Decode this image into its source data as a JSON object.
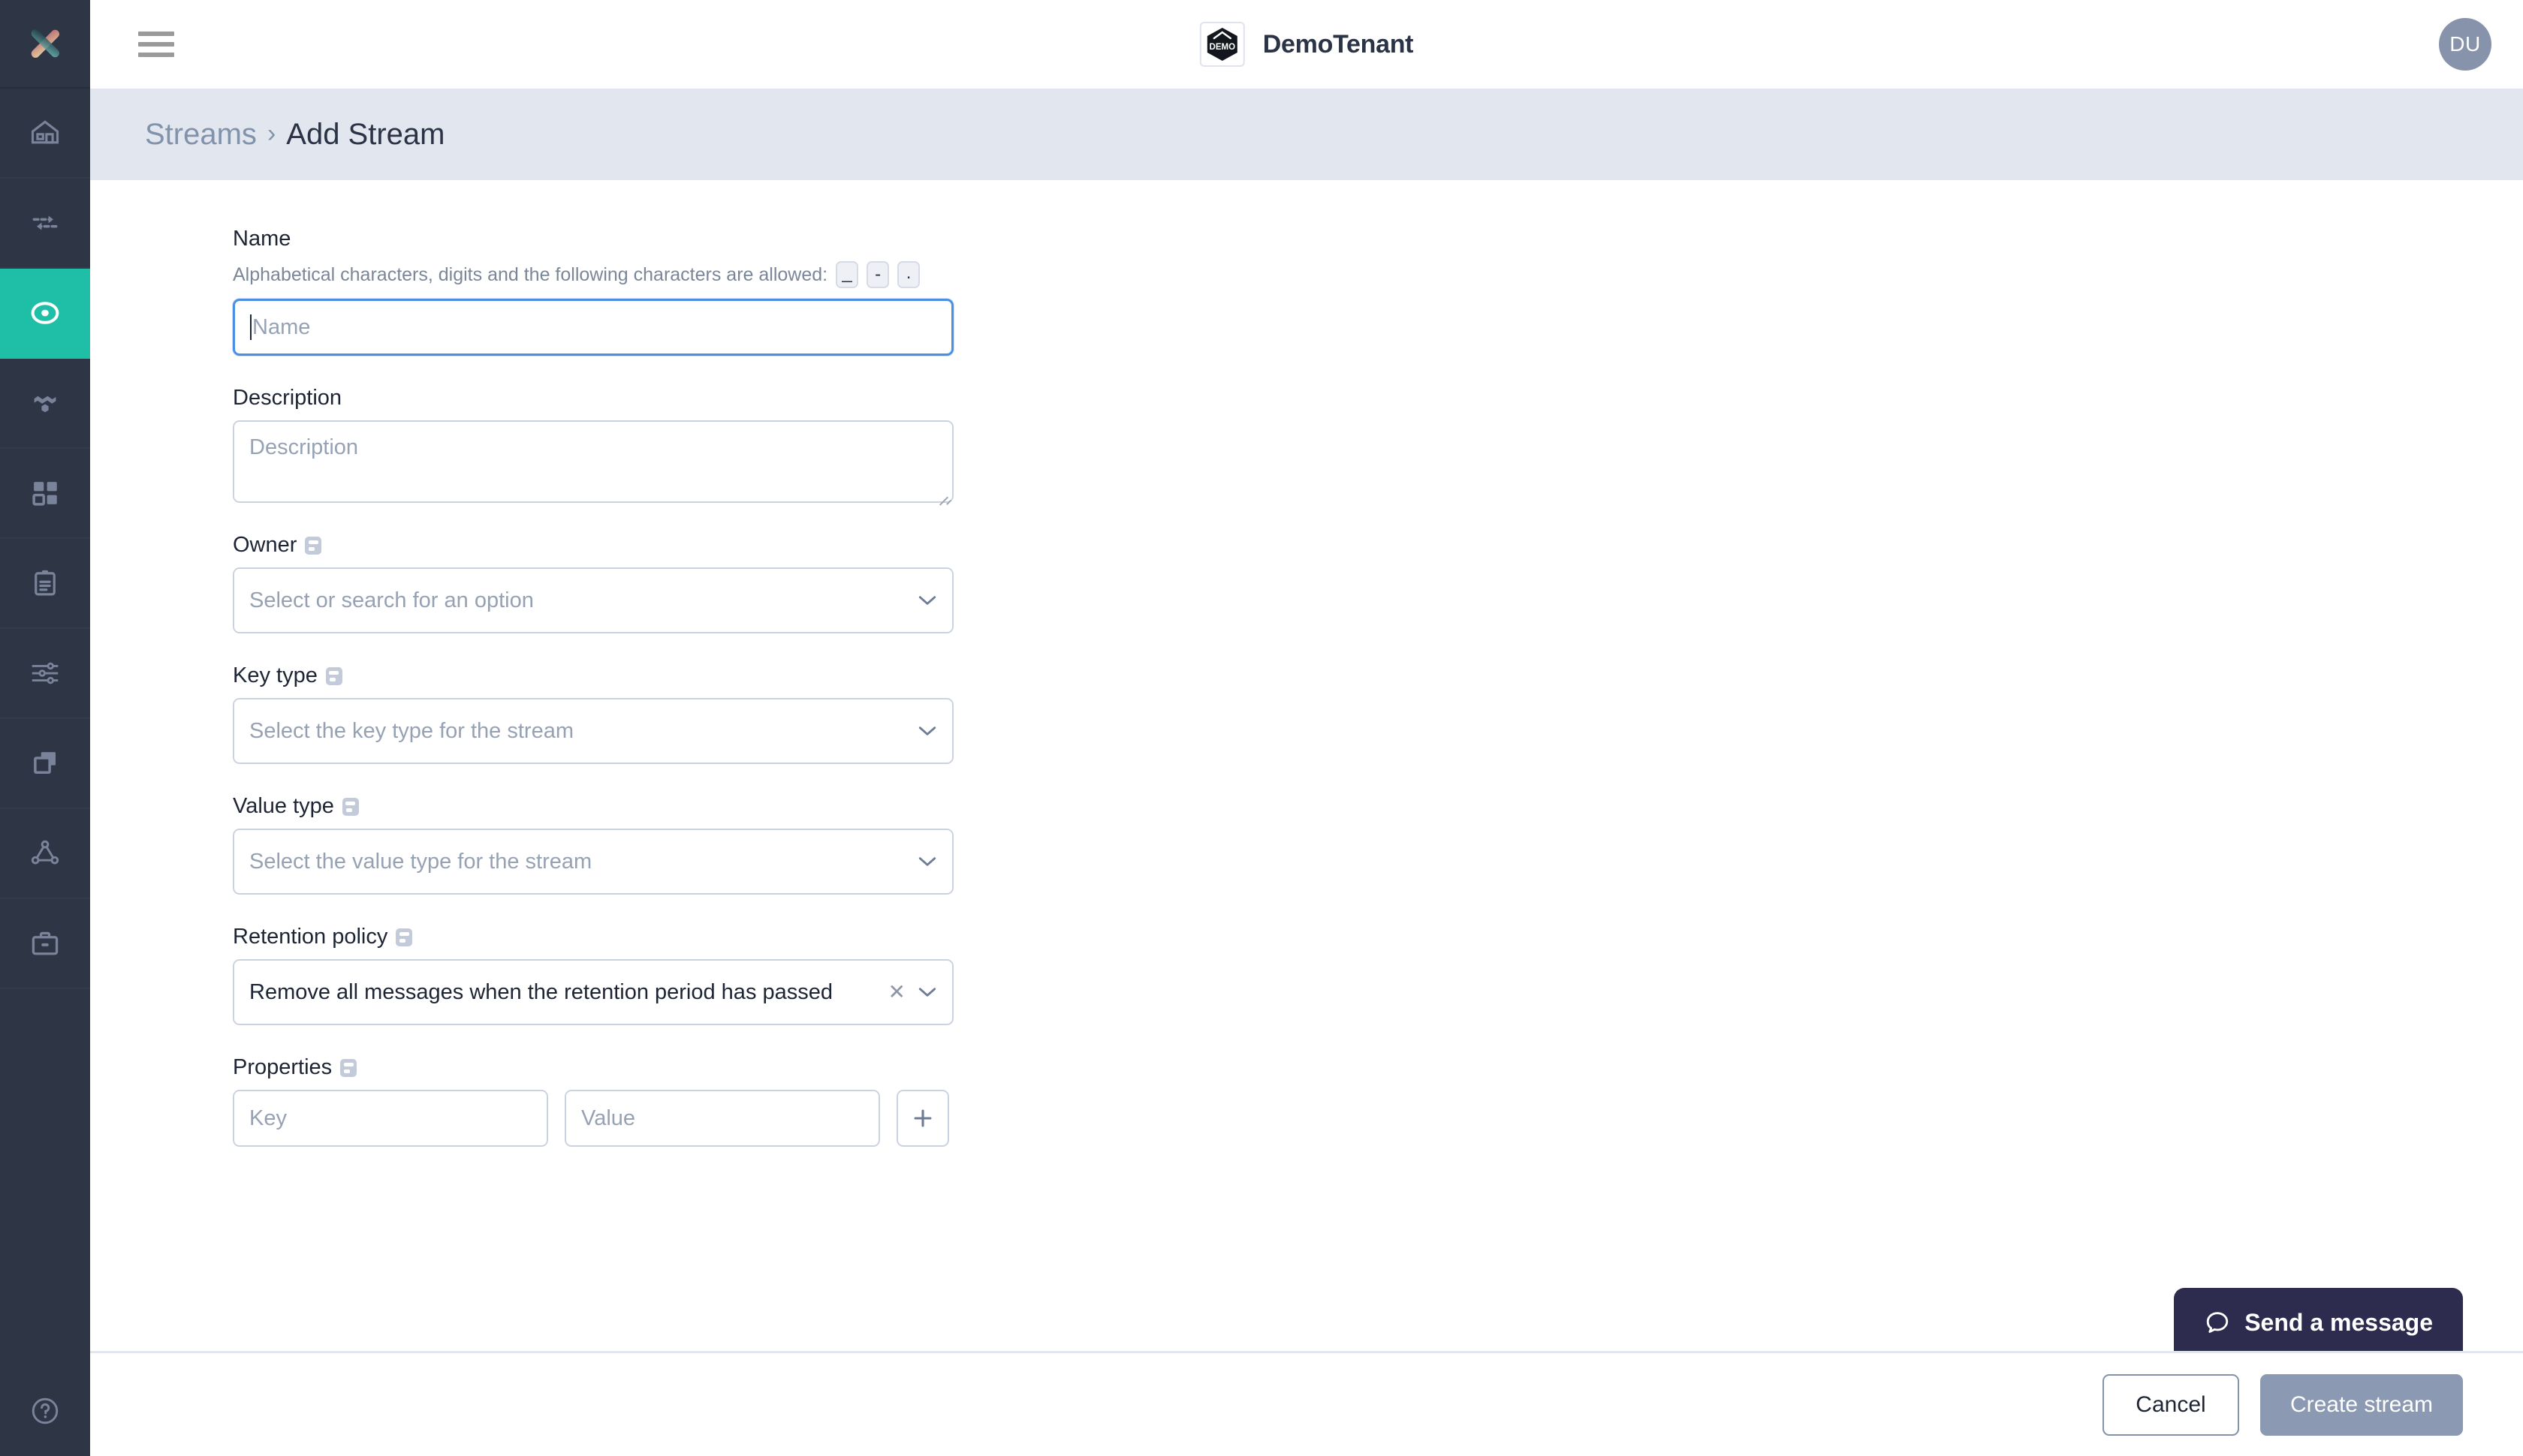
{
  "app": {
    "logo_icon": "x-cross-logo",
    "accent_color": "#1ebfa6",
    "sidebar_bg": "#2e3646",
    "breadcrumb_bg": "#e2e6ee"
  },
  "sidebar": {
    "items": [
      {
        "icon": "home-icon",
        "name": "sidebar-item-home",
        "active": false
      },
      {
        "icon": "exchange-icon",
        "name": "sidebar-item-exchange",
        "active": false
      },
      {
        "icon": "streams-icon",
        "name": "sidebar-item-streams",
        "active": true
      },
      {
        "icon": "topology-icon",
        "name": "sidebar-item-topology",
        "active": false
      },
      {
        "icon": "grid-icon",
        "name": "sidebar-item-apps",
        "active": false
      },
      {
        "icon": "clipboard-icon",
        "name": "sidebar-item-logs",
        "active": false
      },
      {
        "icon": "sliders-icon",
        "name": "sidebar-item-settings",
        "active": false
      },
      {
        "icon": "layers-icon",
        "name": "sidebar-item-layers",
        "active": false
      },
      {
        "icon": "network-icon",
        "name": "sidebar-item-network",
        "active": false
      },
      {
        "icon": "briefcase-icon",
        "name": "sidebar-item-briefcase",
        "active": false
      }
    ],
    "help_icon": "help-circle-icon"
  },
  "topbar": {
    "menu_icon": "hamburger-menu-icon",
    "tenant_logo_text": "DEMO",
    "tenant_name": "DemoTenant",
    "avatar_initials": "DU"
  },
  "breadcrumb": {
    "parent": "Streams",
    "separator": "›",
    "current": "Add Stream"
  },
  "form": {
    "name": {
      "label": "Name",
      "hint": "Alphabetical characters, digits and the following characters are allowed:",
      "allowed_chars": [
        "_",
        "-",
        "."
      ],
      "placeholder": "Name",
      "value": "",
      "focused": true
    },
    "description": {
      "label": "Description",
      "placeholder": "Description",
      "value": ""
    },
    "owner": {
      "label": "Owner",
      "placeholder": "Select or search for an option",
      "value": "",
      "has_info": true
    },
    "key_type": {
      "label": "Key type",
      "placeholder": "Select the key type for the stream",
      "value": "",
      "has_info": true
    },
    "value_type": {
      "label": "Value type",
      "placeholder": "Select the value type for the stream",
      "value": "",
      "has_info": true
    },
    "retention_policy": {
      "label": "Retention policy",
      "value": "Remove all messages when the retention period has passed",
      "has_info": true,
      "clearable": true
    },
    "properties": {
      "label": "Properties",
      "has_info": true,
      "key_placeholder": "Key",
      "key_value": "",
      "value_placeholder": "Value",
      "value_value": "",
      "add_icon": "plus-icon"
    }
  },
  "footer": {
    "cancel_label": "Cancel",
    "create_label": "Create stream"
  },
  "chat": {
    "icon": "chat-bubble-icon",
    "label": "Send a message"
  }
}
